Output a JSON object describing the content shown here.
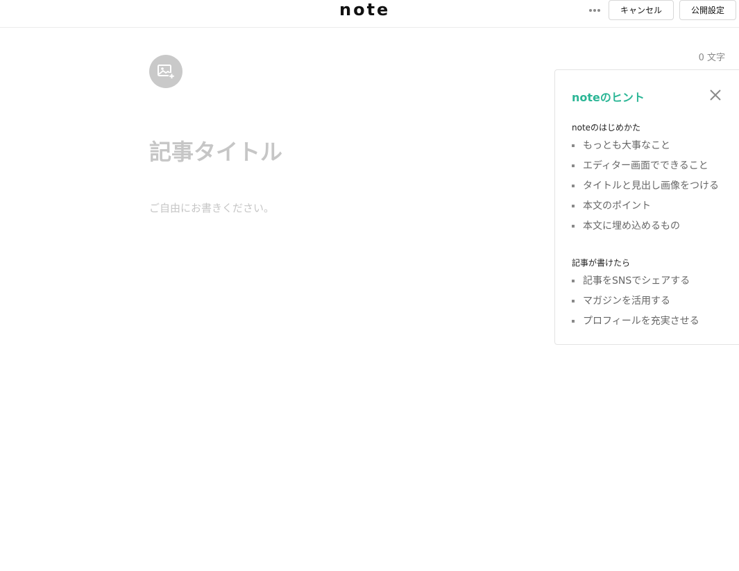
{
  "header": {
    "logo": "note",
    "more_icon": "more-horizontal-icon",
    "cancel_label": "キャンセル",
    "publish_label": "公開設定"
  },
  "editor": {
    "char_count": "0 文字",
    "image_icon": "image-add-icon",
    "title_placeholder": "記事タイトル",
    "body_placeholder": "ご自由にお書きください。"
  },
  "hint_panel": {
    "title": "noteのヒント",
    "close_icon": "close-icon",
    "accent_color": "#2cb696",
    "sections": [
      {
        "title": "noteのはじめかた",
        "items": [
          "もっとも大事なこと",
          "エディター画面でできること",
          "タイトルと見出し画像をつける",
          "本文のポイント",
          "本文に埋め込めるもの"
        ]
      },
      {
        "title": "記事が書けたら",
        "items": [
          "記事をSNSでシェアする",
          "マガジンを活用する",
          "プロフィールを充実させる"
        ]
      }
    ]
  }
}
